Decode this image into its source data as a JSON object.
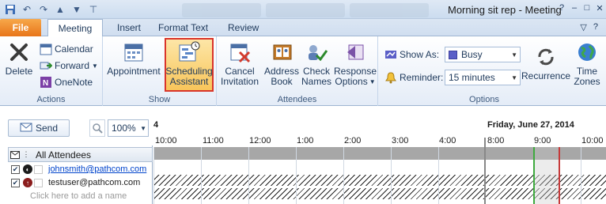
{
  "window": {
    "title": "Morning sit rep  -  Meeting",
    "qat": [
      "save-icon",
      "undo-icon",
      "redo-icon",
      "up-icon",
      "down-icon",
      "customize-icon"
    ],
    "controls": [
      "?",
      "–",
      "□",
      "✕"
    ]
  },
  "tabs": [
    {
      "label": "File"
    },
    {
      "label": "Meeting"
    },
    {
      "label": "Insert"
    },
    {
      "label": "Format Text"
    },
    {
      "label": "Review"
    }
  ],
  "ribbon": {
    "actions": {
      "label": "Actions",
      "delete": "Delete",
      "calendar": "Calendar",
      "forward": "Forward",
      "onenote": "OneNote"
    },
    "show": {
      "label": "Show",
      "appointment": "Appointment",
      "scheduling_l1": "Scheduling",
      "scheduling_l2": "Assistant"
    },
    "attendees": {
      "label": "Attendees",
      "cancel_l1": "Cancel",
      "cancel_l2": "Invitation",
      "address_l1": "Address",
      "address_l2": "Book",
      "check_l1": "Check",
      "check_l2": "Names",
      "response_l1": "Response",
      "response_l2": "Options"
    },
    "options": {
      "label": "Options",
      "show_as_label": "Show As:",
      "show_as_value": "Busy",
      "reminder_label": "Reminder:",
      "reminder_value": "15 minutes",
      "recurrence": "Recurrence",
      "timezones_l1": "Time",
      "timezones_l2": "Zones"
    },
    "colors": {
      "busy": "#5b5fc7",
      "accent_file": "#e8751a",
      "selected_border": "#d9352b"
    }
  },
  "scheduler": {
    "send": "Send",
    "zoom": "100%",
    "partial_date": "4",
    "date": "Friday, June 27, 2014",
    "hours_left": [
      "10:00",
      "11:00",
      "12:00",
      "1:00",
      "2:00",
      "3:00",
      "4:00"
    ],
    "hours_right": [
      "8:00",
      "9:00",
      "10:00"
    ],
    "all_attendees": "All Attendees",
    "attendees": [
      {
        "email": "johnsmith@pathcom.com",
        "status": "organizer"
      },
      {
        "email": "testuser@pathcom.com",
        "status": "required"
      }
    ],
    "add_name": "Click here to add a name"
  }
}
